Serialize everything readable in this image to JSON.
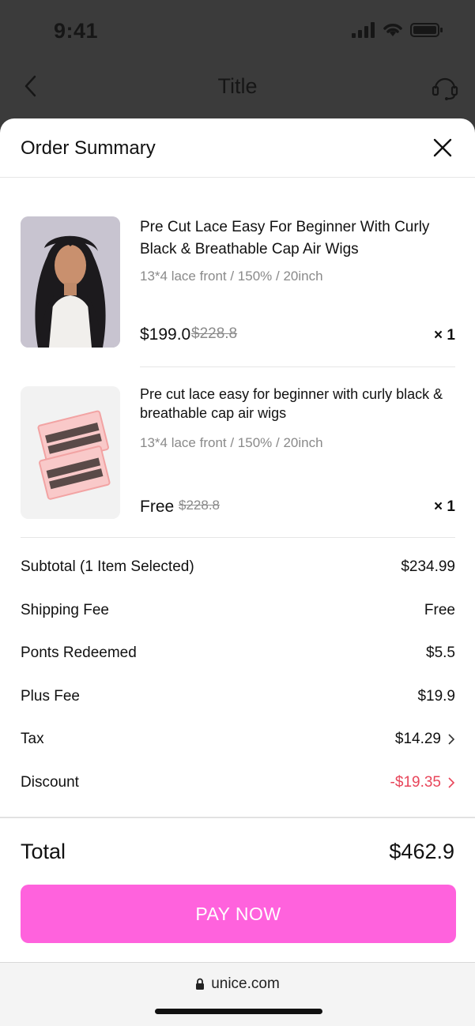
{
  "status_bar": {
    "time": "9:41"
  },
  "nav": {
    "title": "Title"
  },
  "sheet": {
    "title": "Order Summary"
  },
  "items": [
    {
      "title_line1": "Pre Cut Lace Easy For Beginner With Curly",
      "title_line2": "Black & Breathable Cap Air Wigs",
      "variant": "13*4 lace front / 150% / 20inch",
      "price": "$199.0",
      "original_price": "$228.8",
      "quantity": "× 1"
    },
    {
      "title_line1": "Pre cut lace easy for beginner with curly black &",
      "title_line2": "breathable cap air wigs",
      "variant": "13*4 lace front / 150% / 20inch",
      "price": "Free",
      "original_price": "$228.8",
      "quantity": "× 1"
    }
  ],
  "summary": {
    "subtotal_label": "Subtotal (1 Item Selected)",
    "subtotal_value": "$234.99",
    "shipping_label": "Shipping Fee",
    "shipping_value": "Free",
    "points_label": "Ponts Redeemed",
    "points_value": "$5.5",
    "plus_fee_label": "Plus Fee",
    "plus_fee_value": "$19.9",
    "tax_label": "Tax",
    "tax_value": "$14.29",
    "discount_label": "Discount",
    "discount_value": "-$19.35"
  },
  "total": {
    "label": "Total",
    "value": "$462.9"
  },
  "pay_button": {
    "label": "PAY NOW"
  },
  "browser": {
    "url": "unice.com"
  },
  "colors": {
    "accent": "#ff62dd",
    "discount": "#e8455a",
    "muted_text": "#8a8a8a"
  },
  "icons": [
    "back-icon",
    "headset-icon",
    "close-icon",
    "lock-icon",
    "chevron-right-icon",
    "signal-icon",
    "wifi-icon",
    "battery-icon"
  ]
}
